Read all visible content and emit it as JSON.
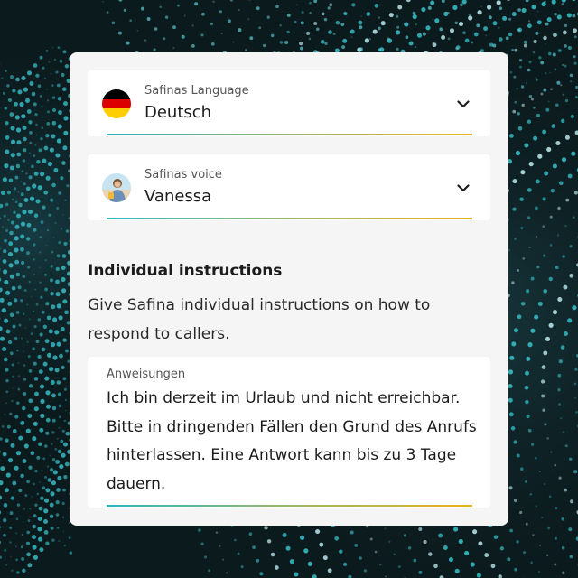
{
  "language": {
    "label": "Safinas Language",
    "value": "Deutsch",
    "flag_colors": [
      "#000000",
      "#dd0000",
      "#ffce00"
    ]
  },
  "voice": {
    "label": "Safinas voice",
    "value": "Vanessa"
  },
  "instructions": {
    "title": "Individual instructions",
    "description": "Give Safina individual instructions on how to respond to callers.",
    "field_label": "Anweisungen",
    "field_value": "Ich bin derzeit im Urlaub und nicht erreichbar. Bitte in dringenden Fällen den Grund des Anrufs hinterlassen. Eine Antwort kann bis zu 3 Tage dauern."
  },
  "colors": {
    "underline_start": "#2bb6c1",
    "underline_end": "#e9b21c",
    "card_background": "#f5f5f5"
  },
  "icons": {
    "dropdown": "chevron-down-icon",
    "language": "germany-flag-icon",
    "voice": "avatar"
  }
}
